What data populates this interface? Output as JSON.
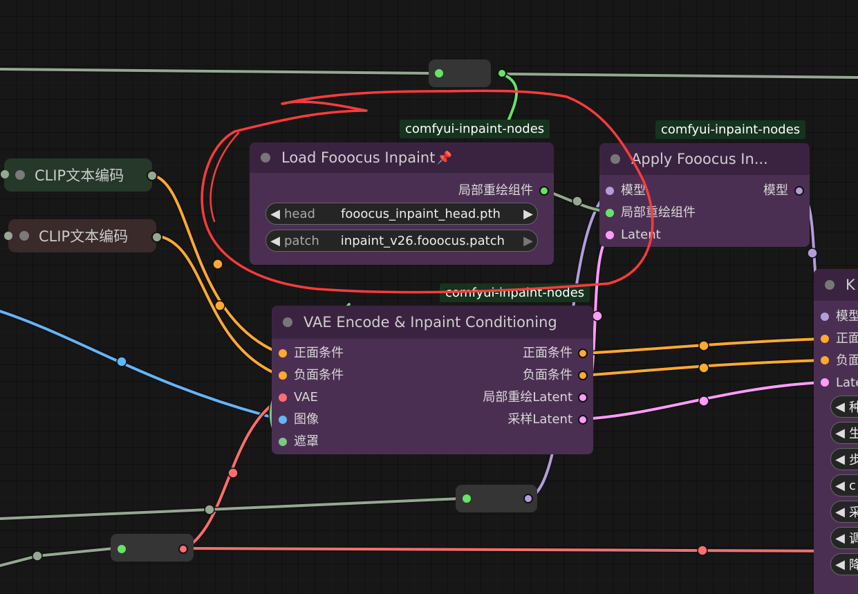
{
  "colors": {
    "conditioning": "#ffa931",
    "vae": "#ff6e6e",
    "image": "#64b5f6",
    "mask": "#81c784",
    "latent": "#ff9cf9",
    "model": "#b39ddb",
    "patch": "#65e465",
    "misc_wire": "#95a892",
    "annotation": "#ff3b3b"
  },
  "tags": {
    "load_inpaint": "comfyui-inpaint-nodes",
    "apply_inpaint": "comfyui-inpaint-nodes",
    "vae_encode": "comfyui-inpaint-nodes"
  },
  "clip_nodes": [
    {
      "title": "CLIP文本编码"
    },
    {
      "title": "CLIP文本编码"
    }
  ],
  "load_inpaint": {
    "title": "Load Fooocus Inpaint",
    "pin_icon": "pin-icon",
    "output": "局部重绘组件",
    "widgets": [
      {
        "name": "head",
        "value": "fooocus_inpaint_head.pth"
      },
      {
        "name": "patch",
        "value": "inpaint_v26.fooocus.patch"
      }
    ]
  },
  "apply_inpaint": {
    "title": "Apply Fooocus In...",
    "inputs": [
      "模型",
      "局部重绘组件",
      "Latent"
    ],
    "output": "模型"
  },
  "vae_encode": {
    "title": "VAE Encode & Inpaint Conditioning",
    "inputs": [
      "正面条件",
      "负面条件",
      "VAE",
      "图像",
      "遮罩"
    ],
    "outputs": [
      "正面条件",
      "负面条件",
      "局部重绘Latent",
      "采样Latent"
    ]
  },
  "ksampler": {
    "title": "K",
    "inputs": [
      "模型",
      "正面",
      "负面",
      "Late"
    ],
    "widgets": [
      "种",
      "生",
      "步",
      "c",
      "采",
      "调",
      "降"
    ]
  }
}
